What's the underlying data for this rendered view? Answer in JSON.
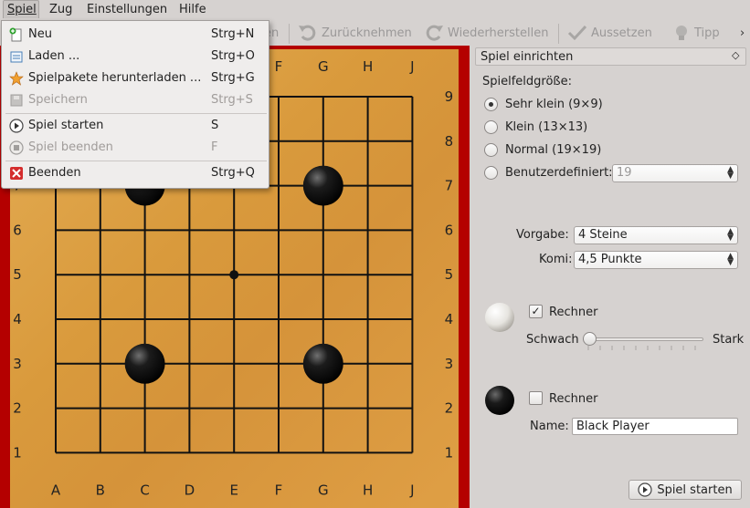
{
  "menubar": {
    "items": [
      {
        "label": "Spiel"
      },
      {
        "label": "Zug"
      },
      {
        "label": "Einstellungen"
      },
      {
        "label": "Hilfe"
      }
    ]
  },
  "toolbar": {
    "items": [
      {
        "label": "en",
        "icon": "redo-icon"
      },
      {
        "label": "Zurücknehmen",
        "icon": "undo-icon"
      },
      {
        "label": "Wiederherstellen",
        "icon": "redo-icon"
      },
      {
        "label": "Aussetzen",
        "icon": "check-icon"
      },
      {
        "label": "Tipp",
        "icon": "lightbulb-icon"
      }
    ],
    "overflow": "›"
  },
  "menu": {
    "items": [
      {
        "label": "Neu",
        "shortcut": "Strg+N",
        "icon": "new-icon",
        "enabled": true
      },
      {
        "label": "Laden ...",
        "shortcut": "Strg+O",
        "icon": "open-icon",
        "enabled": true
      },
      {
        "label": "Spielpakete herunterladen ...",
        "shortcut": "Strg+G",
        "icon": "star-icon",
        "enabled": true
      },
      {
        "label": "Speichern",
        "shortcut": "Strg+S",
        "icon": "save-icon",
        "enabled": false
      },
      {
        "label": "Spiel starten",
        "shortcut": "S",
        "icon": "play-icon",
        "enabled": true
      },
      {
        "label": "Spiel beenden",
        "shortcut": "F",
        "icon": "stop-icon",
        "enabled": false
      },
      {
        "label": "Beenden",
        "shortcut": "Strg+Q",
        "icon": "quit-icon",
        "enabled": true
      }
    ]
  },
  "board": {
    "columns": [
      "A",
      "B",
      "C",
      "D",
      "E",
      "F",
      "G",
      "H",
      "J"
    ],
    "rows": [
      "9",
      "8",
      "7",
      "6",
      "5",
      "4",
      "3",
      "2",
      "1"
    ],
    "stones": [
      {
        "color": "black",
        "pos": "C7"
      },
      {
        "color": "black",
        "pos": "G7"
      },
      {
        "color": "black",
        "pos": "C3"
      },
      {
        "color": "black",
        "pos": "G3"
      }
    ],
    "star_point": "E5"
  },
  "panel": {
    "title": "Spiel einrichten",
    "float_icon": "◇",
    "size_label": "Spielfeldgröße:",
    "sizes": [
      {
        "label": "Sehr klein (9×9)",
        "selected": true
      },
      {
        "label": "Klein (13×13)",
        "selected": false
      },
      {
        "label": "Normal (19×19)",
        "selected": false
      },
      {
        "label": "Benutzerdefiniert:",
        "selected": false
      }
    ],
    "custom_size": "19",
    "handicap_label": "Vorgabe:",
    "handicap_value": "4 Steine",
    "komi_label": "Komi:",
    "komi_value": "4,5 Punkte",
    "white": {
      "computer_label": "Rechner",
      "computer_checked": true,
      "weak": "Schwach",
      "strong": "Stark",
      "strength": 0
    },
    "black": {
      "computer_label": "Rechner",
      "computer_checked": false,
      "name_label": "Name:",
      "name_value": "Black Player"
    },
    "start_button": "Spiel starten"
  }
}
